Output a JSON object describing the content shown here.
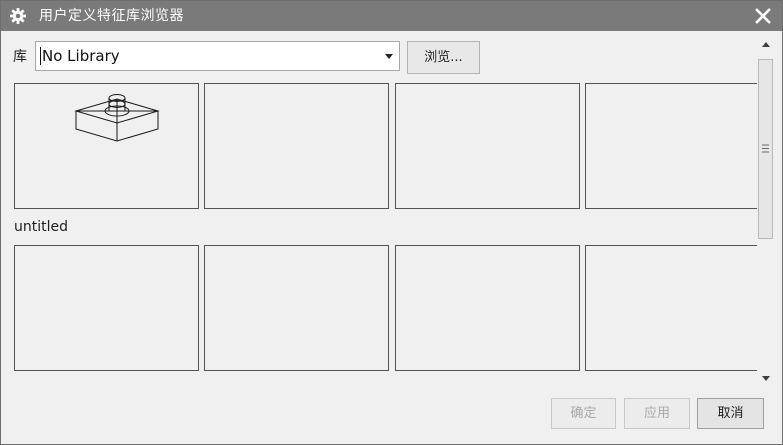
{
  "window": {
    "title": "用户定义特征库浏览器",
    "icon": "gear-icon",
    "close_icon": "close-icon"
  },
  "library": {
    "label": "库",
    "selected": "No Library",
    "browse_label": "浏览..."
  },
  "gallery": {
    "groups": [
      {
        "label": "",
        "item_count": 4,
        "first_item_preview": "isometric-box-with-cylinder"
      },
      {
        "label": "untitled",
        "item_count": 4
      }
    ]
  },
  "footer": {
    "ok_label": "确定",
    "apply_label": "应用",
    "cancel_label": "取消"
  },
  "colors": {
    "titlebar": "#7a7a7a",
    "background": "#f0f0f0",
    "cell_border": "#545454"
  }
}
